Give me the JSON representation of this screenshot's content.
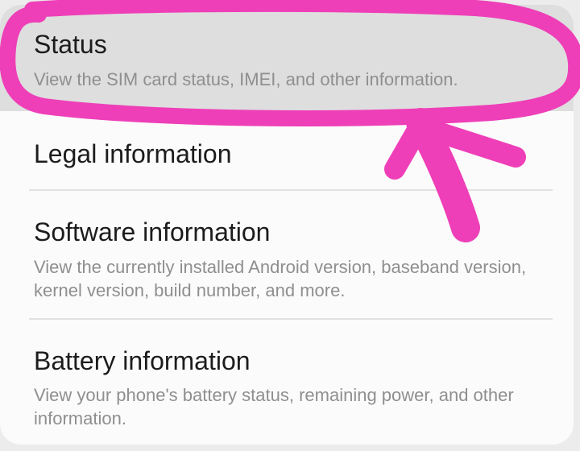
{
  "settings_list": {
    "items": [
      {
        "title": "Status",
        "summary": "View the SIM card status, IMEI, and other information."
      },
      {
        "title": "Legal information",
        "summary": ""
      },
      {
        "title": "Software information",
        "summary": "View the currently installed Android version, baseband version, kernel version, build number, and more."
      },
      {
        "title": "Battery information",
        "summary": "View your phone's battery status, remaining power, and other information."
      }
    ]
  },
  "annotation": {
    "highlight_color": "#ee3fb8",
    "shapes": [
      "circle-around-status",
      "arrow-pointing-to-status"
    ]
  }
}
